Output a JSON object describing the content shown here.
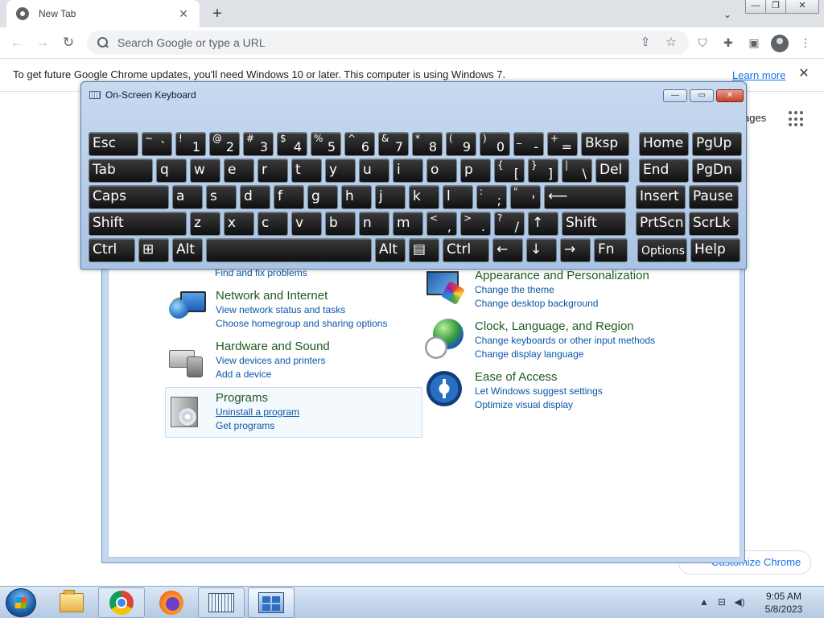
{
  "browser": {
    "tab_title": "New Tab",
    "tab_close": "✕",
    "new_tab": "+",
    "tab_search": "⌄",
    "window_controls": {
      "minimize": "—",
      "restore": "❐",
      "close": "✕"
    },
    "nav": {
      "back": "←",
      "forward": "→",
      "reload": "↻"
    },
    "omnibox_placeholder": "Search Google or type a URL",
    "share_icon": "⇪",
    "star_icon": "☆",
    "toolbar_icons": {
      "shield": "⛉",
      "extensions": "✚",
      "sidepanel": "▣",
      "menu": "⋮"
    },
    "infobar": {
      "text": "To get future Google Chrome updates, you'll need Windows 10 or later. This computer is using Windows 7.",
      "link": "Learn more",
      "close": "✕"
    },
    "ntp": {
      "images_link": "ages",
      "customize": "Customize Chrome"
    }
  },
  "control_panel": {
    "orphan_link": "Find and fix problems",
    "categories": [
      {
        "title": "Network and Internet",
        "links": [
          "View network status and tasks",
          "Choose homegroup and sharing options"
        ]
      },
      {
        "title": "Hardware and Sound",
        "links": [
          "View devices and printers",
          "Add a device"
        ]
      },
      {
        "title": "Programs",
        "links": [
          "Uninstall a program",
          "Get programs"
        ]
      },
      {
        "title": "Appearance and Personalization",
        "links": [
          "Change the theme",
          "Change desktop background"
        ]
      },
      {
        "title": "Clock, Language, and Region",
        "links": [
          "Change keyboards or other input methods",
          "Change display language"
        ]
      },
      {
        "title": "Ease of Access",
        "links": [
          "Let Windows suggest settings",
          "Optimize visual display"
        ]
      }
    ]
  },
  "osk": {
    "title": "On-Screen Keyboard",
    "controls": {
      "minimize": "—",
      "restore": "▭",
      "close": "✕"
    },
    "rows": [
      [
        {
          "t": "Esc",
          "w": 62,
          "name": "esc"
        },
        {
          "top": "~",
          "bot": "`",
          "w": 38,
          "name": "backtick"
        },
        {
          "top": "!",
          "bot": "1",
          "w": 38,
          "name": "1"
        },
        {
          "top": "@",
          "bot": "2",
          "w": 38,
          "name": "2"
        },
        {
          "top": "#",
          "bot": "3",
          "w": 38,
          "name": "3"
        },
        {
          "top": "$",
          "bot": "4",
          "w": 38,
          "name": "4"
        },
        {
          "top": "%",
          "bot": "5",
          "w": 38,
          "name": "5"
        },
        {
          "top": "^",
          "bot": "6",
          "w": 38,
          "name": "6"
        },
        {
          "top": "&",
          "bot": "7",
          "w": 38,
          "name": "7"
        },
        {
          "top": "*",
          "bot": "8",
          "w": 38,
          "name": "8"
        },
        {
          "top": "(",
          "bot": "9",
          "w": 38,
          "name": "9"
        },
        {
          "top": ")",
          "bot": "0",
          "w": 38,
          "name": "0"
        },
        {
          "top": "_",
          "bot": "-",
          "w": 38,
          "name": "minus"
        },
        {
          "top": "+",
          "bot": "=",
          "w": 38,
          "name": "equals"
        },
        {
          "t": "Bksp",
          "w": 60,
          "name": "backspace"
        },
        {
          "t": "Home",
          "w": 62,
          "name": "home",
          "gap": 8
        },
        {
          "t": "PgUp",
          "w": 62,
          "name": "pgup"
        }
      ],
      [
        {
          "t": "Tab",
          "w": 80,
          "name": "tab"
        },
        {
          "t": "q",
          "w": 38,
          "name": "q"
        },
        {
          "t": "w",
          "w": 38,
          "name": "w"
        },
        {
          "t": "e",
          "w": 38,
          "name": "e"
        },
        {
          "t": "r",
          "w": 38,
          "name": "r"
        },
        {
          "t": "t",
          "w": 38,
          "name": "t"
        },
        {
          "t": "y",
          "w": 38,
          "name": "y"
        },
        {
          "t": "u",
          "w": 38,
          "name": "u"
        },
        {
          "t": "i",
          "w": 38,
          "name": "i"
        },
        {
          "t": "o",
          "w": 38,
          "name": "o"
        },
        {
          "t": "p",
          "w": 38,
          "name": "p"
        },
        {
          "top": "{",
          "bot": "[",
          "w": 38,
          "name": "lbracket"
        },
        {
          "top": "}",
          "bot": "]",
          "w": 38,
          "name": "rbracket"
        },
        {
          "top": "|",
          "bot": "\\",
          "w": 38,
          "name": "backslash"
        },
        {
          "t": "Del",
          "w": 42,
          "name": "del"
        },
        {
          "t": "End",
          "w": 62,
          "name": "end",
          "gap": 8
        },
        {
          "t": "PgDn",
          "w": 62,
          "name": "pgdn"
        }
      ],
      [
        {
          "t": "Caps",
          "w": 100,
          "name": "caps"
        },
        {
          "t": "a",
          "w": 38,
          "name": "a"
        },
        {
          "t": "s",
          "w": 38,
          "name": "s"
        },
        {
          "t": "d",
          "w": 38,
          "name": "d"
        },
        {
          "t": "f",
          "w": 38,
          "name": "f"
        },
        {
          "t": "g",
          "w": 38,
          "name": "g"
        },
        {
          "t": "h",
          "w": 38,
          "name": "h"
        },
        {
          "t": "j",
          "w": 38,
          "name": "j"
        },
        {
          "t": "k",
          "w": 38,
          "name": "k"
        },
        {
          "t": "l",
          "w": 38,
          "name": "l"
        },
        {
          "top": ":",
          "bot": ";",
          "w": 38,
          "name": "semicolon"
        },
        {
          "top": "\"",
          "bot": "'",
          "w": 38,
          "name": "quote"
        },
        {
          "t": "⟵",
          "w": 102,
          "name": "enter"
        },
        {
          "t": "Insert",
          "w": 62,
          "name": "insert",
          "gap": 8
        },
        {
          "t": "Pause",
          "w": 62,
          "name": "pause"
        }
      ],
      [
        {
          "t": "Shift",
          "w": 122,
          "name": "lshift"
        },
        {
          "t": "z",
          "w": 38,
          "name": "z"
        },
        {
          "t": "x",
          "w": 38,
          "name": "x"
        },
        {
          "t": "c",
          "w": 38,
          "name": "c"
        },
        {
          "t": "v",
          "w": 38,
          "name": "v"
        },
        {
          "t": "b",
          "w": 38,
          "name": "b"
        },
        {
          "t": "n",
          "w": 38,
          "name": "n"
        },
        {
          "t": "m",
          "w": 38,
          "name": "m"
        },
        {
          "top": "<",
          "bot": ",",
          "w": 38,
          "name": "comma"
        },
        {
          "top": ">",
          "bot": ".",
          "w": 38,
          "name": "period"
        },
        {
          "top": "?",
          "bot": "/",
          "w": 38,
          "name": "slash"
        },
        {
          "t": "↑",
          "w": 38,
          "name": "up"
        },
        {
          "t": "Shift",
          "w": 80,
          "name": "rshift"
        },
        {
          "t": "PrtScn",
          "w": 62,
          "name": "prtscn",
          "gap": 8
        },
        {
          "t": "ScrLk",
          "w": 62,
          "name": "scrlk"
        }
      ],
      [
        {
          "t": "Ctrl",
          "w": 58,
          "name": "lctrl"
        },
        {
          "t": "⊞",
          "w": 38,
          "name": "win"
        },
        {
          "t": "Alt",
          "w": 38,
          "name": "lalt"
        },
        {
          "t": "",
          "w": 206,
          "name": "space"
        },
        {
          "t": "Alt",
          "w": 38,
          "name": "ralt"
        },
        {
          "t": "▤",
          "w": 38,
          "name": "menu"
        },
        {
          "t": "Ctrl",
          "w": 58,
          "name": "rctrl"
        },
        {
          "t": "←",
          "w": 38,
          "name": "left"
        },
        {
          "t": "↓",
          "w": 38,
          "name": "down"
        },
        {
          "t": "→",
          "w": 38,
          "name": "right"
        },
        {
          "t": "Fn",
          "w": 42,
          "name": "fn"
        },
        {
          "t": "Options",
          "w": 62,
          "name": "options",
          "gap": 8,
          "small": true
        },
        {
          "t": "Help",
          "w": 62,
          "name": "help"
        }
      ]
    ]
  },
  "taskbar": {
    "clock_time": "9:05 AM",
    "clock_date": "5/8/2023",
    "tray": {
      "chevron": "▲",
      "network": "⊟",
      "volume": "◀)"
    }
  }
}
